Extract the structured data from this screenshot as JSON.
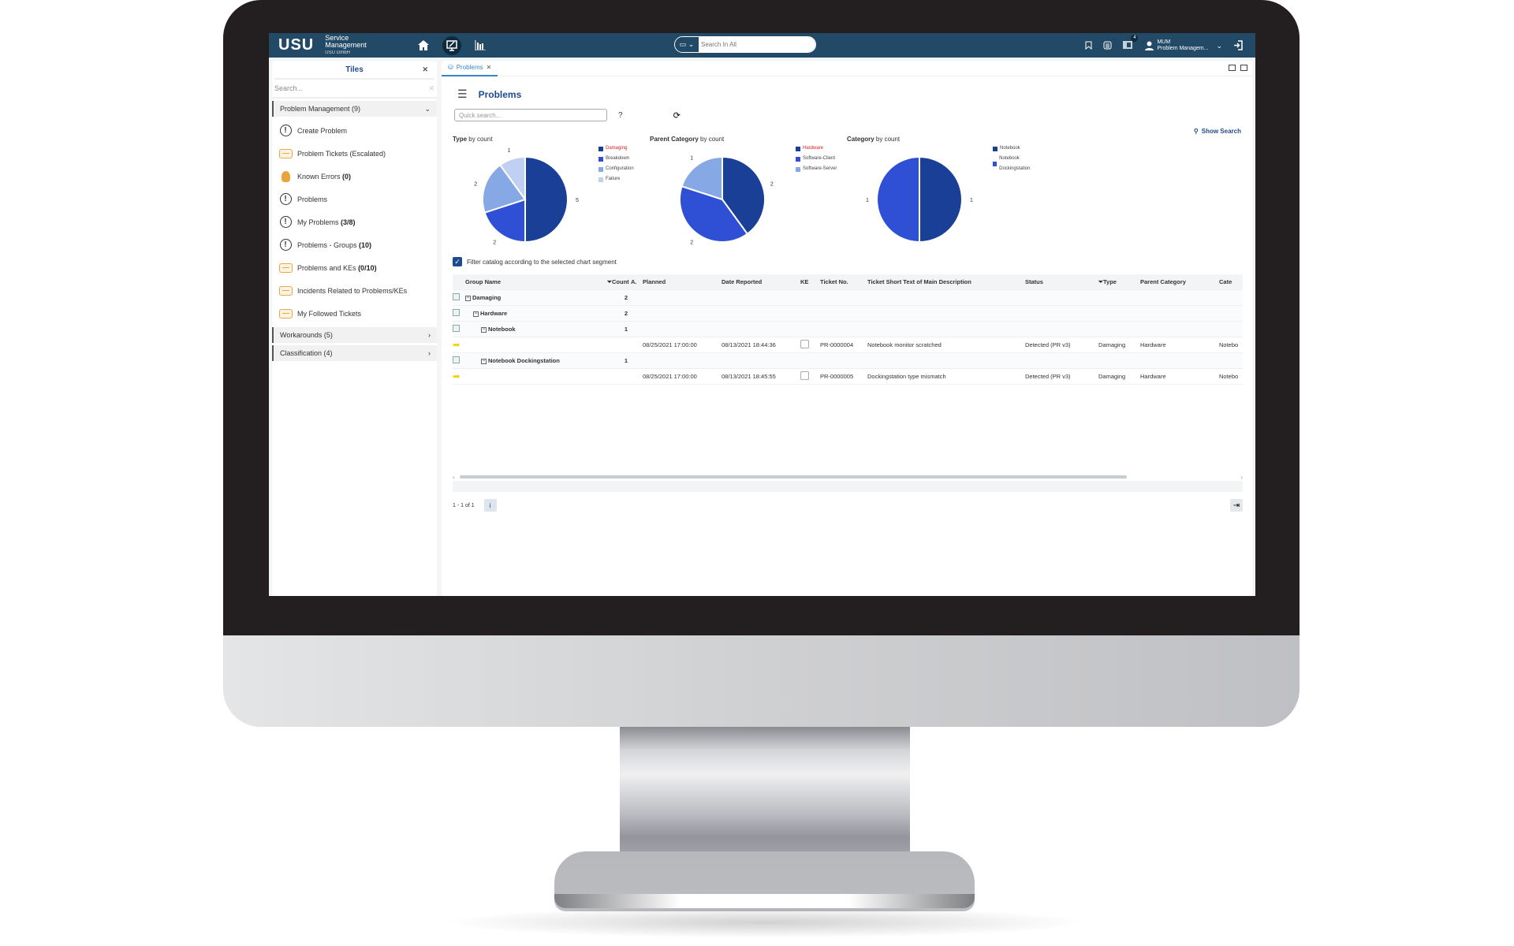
{
  "app": {
    "logo": "USU",
    "brand_line1": "Service",
    "brand_line2": "Management",
    "brand_company": "USU GmbH"
  },
  "header": {
    "search_placeholder": "Search In All",
    "notifications_badge": "4",
    "user_name": "MUM",
    "user_role": "Problem Managem..."
  },
  "sidebar": {
    "title": "Tiles",
    "search_placeholder": "Search...",
    "group_open": "Problem Management (9)",
    "items": [
      {
        "label": "Create Problem",
        "count": "",
        "icon": "create-problem-icon"
      },
      {
        "label": "Problem Tickets (Escalated)",
        "count": "",
        "icon": "ticket-icon"
      },
      {
        "label": "Known Errors",
        "count": "(0)",
        "icon": "bulb-icon"
      },
      {
        "label": "Problems",
        "count": "",
        "icon": "problem-icon"
      },
      {
        "label": "My Problems",
        "count": "(3/8)",
        "icon": "my-problem-icon"
      },
      {
        "label": "Problems - Groups",
        "count": "(10)",
        "icon": "group-problem-icon"
      },
      {
        "label": "Problems and KEs",
        "count": "(0/10)",
        "icon": "ticket-icon"
      },
      {
        "label": "Incidents Related to Problems/KEs",
        "count": "",
        "icon": "ticket-icon"
      },
      {
        "label": "My Followed Tickets",
        "count": "",
        "icon": "followed-ticket-icon"
      }
    ],
    "groups_closed": [
      "Workarounds (5)",
      "Classification (4)"
    ]
  },
  "main": {
    "tab_label": "Problems",
    "title": "Problems",
    "quick_search_placeholder": "Quick search...",
    "help": "?",
    "show_search": "Show Search",
    "filter_label": "Filter catalog according to the selected chart segment",
    "pager": "1 - 1 of 1"
  },
  "chart_data": [
    {
      "type": "pie",
      "title_bold": "Type",
      "title_rest": " by count",
      "categories": [
        "Damaging",
        "Breakdown",
        "Configuration",
        "Failure"
      ],
      "values": [
        5,
        2,
        2,
        1
      ],
      "colors": [
        "#1a3f96",
        "#2f4fd4",
        "#86a8e4",
        "#c0d0f2"
      ],
      "highlight": "Damaging"
    },
    {
      "type": "pie",
      "title_bold": "Parent Category",
      "title_rest": " by count",
      "categories": [
        "Hardware",
        "Software-Client",
        "Software-Server"
      ],
      "values": [
        2,
        2,
        1
      ],
      "colors": [
        "#1a3f96",
        "#2f4fd4",
        "#86a8e4"
      ],
      "highlight": "Hardware"
    },
    {
      "type": "pie",
      "title_bold": "Category",
      "title_rest": " by count",
      "categories": [
        "Notebook",
        "Notebook Dockingstation"
      ],
      "values": [
        1,
        1
      ],
      "colors": [
        "#1a3f96",
        "#2f4fd4"
      ],
      "highlight": ""
    }
  ],
  "table": {
    "columns": [
      "Group Name",
      "Count",
      "A.",
      "Planned",
      "Date Reported",
      "KE",
      "Ticket No.",
      "Ticket Short Text of Main Description",
      "Status",
      "Type",
      "Parent Category",
      "Cate"
    ],
    "rows": [
      {
        "kind": "group",
        "level": 0,
        "name": "Damaging",
        "count": "2"
      },
      {
        "kind": "group",
        "level": 1,
        "name": "Hardware",
        "count": "2"
      },
      {
        "kind": "group",
        "level": 2,
        "name": "Notebook",
        "count": "1"
      },
      {
        "kind": "data",
        "planned": "08/25/2021 17:00:00",
        "reported": "08/13/2021 18:44:36",
        "ticket": "PR-0000004",
        "text": "Notebook monitor scratched",
        "status": "Detected (PR v3)",
        "type": "Damaging",
        "parent": "Hardware",
        "cat": "Notebo"
      },
      {
        "kind": "group",
        "level": 2,
        "name": "Notebook Dockingstation",
        "count": "1"
      },
      {
        "kind": "data",
        "planned": "08/25/2021 17:00:00",
        "reported": "08/13/2021 18:45:55",
        "ticket": "PR-0000005",
        "text": "Dockingstation type mismatch",
        "status": "Detected (PR v3)",
        "type": "Damaging",
        "parent": "Hardware",
        "cat": "Notebo"
      }
    ]
  }
}
